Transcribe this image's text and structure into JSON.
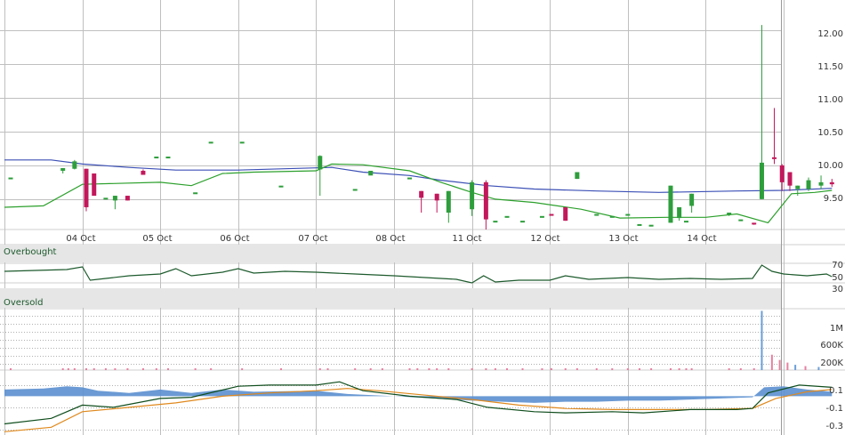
{
  "colors": {
    "up": "#2e9e3c",
    "down": "#c2185b",
    "ma_short": "#2ca02c",
    "ma_long": "#3b4fb5",
    "rsi": "#1c5a2c",
    "volume_up": "#6a9fd8",
    "volume_down": "#e87fa0",
    "macd_line": "#0f4d1c",
    "macd_signal": "#e0891d",
    "histogram": "#5b8fcf",
    "band": "#e6e6e6",
    "grid": "#bfbfbf"
  },
  "chart_data": [
    {
      "id": "price",
      "type": "candlestick",
      "x_labels": [
        "04 Oct",
        "05 Oct",
        "06 Oct",
        "07 Oct",
        "08 Oct",
        "11 Oct",
        "12 Oct",
        "13 Oct",
        "14 Oct"
      ],
      "y_ticks": [
        "12.00",
        "11.50",
        "11.00",
        "10.50",
        "10.00",
        "9.50"
      ],
      "ylim": [
        9.05,
        12.45
      ],
      "grid": true,
      "candles": [
        {
          "t": 0.08,
          "o": 9.82,
          "h": 9.82,
          "l": 9.82,
          "c": 9.82
        },
        {
          "t": 0.75,
          "o": 9.92,
          "h": 9.93,
          "l": 9.88,
          "c": 9.96
        },
        {
          "t": 0.9,
          "o": 9.95,
          "h": 10.08,
          "l": 9.94,
          "c": 10.06
        },
        {
          "t": 1.05,
          "o": 9.95,
          "h": 9.95,
          "l": 9.32,
          "c": 9.38
        },
        {
          "t": 1.15,
          "o": 9.88,
          "h": 9.88,
          "l": 9.55,
          "c": 9.55
        },
        {
          "t": 1.3,
          "o": 9.52,
          "h": 9.52,
          "l": 9.52,
          "c": 9.52
        },
        {
          "t": 1.42,
          "o": 9.48,
          "h": 9.55,
          "l": 9.35,
          "c": 9.55
        },
        {
          "t": 1.58,
          "o": 9.55,
          "h": 9.55,
          "l": 9.48,
          "c": 9.48
        },
        {
          "t": 1.78,
          "o": 9.92,
          "h": 9.94,
          "l": 9.88,
          "c": 9.86
        },
        {
          "t": 1.95,
          "o": 10.13,
          "h": 10.13,
          "l": 10.13,
          "c": 10.13
        },
        {
          "t": 2.1,
          "o": 10.13,
          "h": 10.13,
          "l": 10.13,
          "c": 10.13
        },
        {
          "t": 2.45,
          "o": 9.6,
          "h": 9.6,
          "l": 9.6,
          "c": 9.6
        },
        {
          "t": 2.65,
          "o": 10.35,
          "h": 10.35,
          "l": 10.35,
          "c": 10.35
        },
        {
          "t": 3.05,
          "o": 10.35,
          "h": 10.35,
          "l": 10.35,
          "c": 10.35
        },
        {
          "t": 3.55,
          "o": 9.7,
          "h": 9.7,
          "l": 9.7,
          "c": 9.7
        },
        {
          "t": 4.05,
          "o": 9.94,
          "h": 10.15,
          "l": 9.55,
          "c": 10.14
        },
        {
          "t": 4.5,
          "o": 9.65,
          "h": 9.65,
          "l": 9.65,
          "c": 9.65
        },
        {
          "t": 4.7,
          "o": 9.85,
          "h": 9.85,
          "l": 9.85,
          "c": 9.92
        },
        {
          "t": 5.2,
          "o": 9.82,
          "h": 9.82,
          "l": 9.82,
          "c": 9.82
        },
        {
          "t": 5.35,
          "o": 9.62,
          "h": 9.62,
          "l": 9.3,
          "c": 9.52
        },
        {
          "t": 5.55,
          "o": 9.58,
          "h": 9.58,
          "l": 9.3,
          "c": 9.48
        },
        {
          "t": 5.7,
          "o": 9.3,
          "h": 9.62,
          "l": 9.15,
          "c": 9.62
        },
        {
          "t": 6.0,
          "o": 9.35,
          "h": 9.78,
          "l": 9.25,
          "c": 9.75
        },
        {
          "t": 6.18,
          "o": 9.75,
          "h": 9.78,
          "l": 9.05,
          "c": 9.2
        },
        {
          "t": 6.3,
          "o": 9.18,
          "h": 9.18,
          "l": 9.18,
          "c": 9.18
        },
        {
          "t": 6.45,
          "o": 9.25,
          "h": 9.25,
          "l": 9.25,
          "c": 9.25
        },
        {
          "t": 6.65,
          "o": 9.18,
          "h": 9.18,
          "l": 9.18,
          "c": 9.18
        },
        {
          "t": 6.9,
          "o": 9.25,
          "h": 9.25,
          "l": 9.25,
          "c": 9.25
        },
        {
          "t": 7.02,
          "o": 9.28,
          "h": 9.28,
          "l": 9.28,
          "c": 9.26
        },
        {
          "t": 7.2,
          "o": 9.38,
          "h": 9.38,
          "l": 9.18,
          "c": 9.18
        },
        {
          "t": 7.35,
          "o": 9.8,
          "h": 9.9,
          "l": 9.8,
          "c": 9.9
        },
        {
          "t": 7.6,
          "o": 9.28,
          "h": 9.28,
          "l": 9.28,
          "c": 9.28
        },
        {
          "t": 7.8,
          "o": 9.25,
          "h": 9.25,
          "l": 9.25,
          "c": 9.25
        },
        {
          "t": 8.0,
          "o": 9.28,
          "h": 9.28,
          "l": 9.28,
          "c": 9.28
        },
        {
          "t": 8.15,
          "o": 9.13,
          "h": 9.13,
          "l": 9.13,
          "c": 9.13
        },
        {
          "t": 8.3,
          "o": 9.12,
          "h": 9.12,
          "l": 9.12,
          "c": 9.12
        },
        {
          "t": 8.55,
          "o": 9.15,
          "h": 9.7,
          "l": 9.15,
          "c": 9.7
        },
        {
          "t": 8.66,
          "o": 9.22,
          "h": 9.38,
          "l": 9.18,
          "c": 9.38
        },
        {
          "t": 8.75,
          "o": 9.18,
          "h": 9.18,
          "l": 9.18,
          "c": 9.18
        },
        {
          "t": 8.82,
          "o": 9.4,
          "h": 9.58,
          "l": 9.3,
          "c": 9.58
        },
        {
          "t": 9.3,
          "o": 9.28,
          "h": 9.3,
          "l": 9.25,
          "c": 9.3
        },
        {
          "t": 9.45,
          "o": 9.2,
          "h": 9.2,
          "l": 9.2,
          "c": 9.2
        },
        {
          "t": 9.62,
          "o": 9.15,
          "h": 9.15,
          "l": 9.12,
          "c": 9.14
        },
        {
          "t": 9.72,
          "o": 9.5,
          "h": 12.08,
          "l": 9.5,
          "c": 10.04
        },
        {
          "t": 9.88,
          "o": 10.12,
          "h": 10.85,
          "l": 10.02,
          "c": 10.1
        },
        {
          "t": 9.98,
          "o": 10.0,
          "h": 10.02,
          "l": 9.62,
          "c": 9.75
        },
        {
          "t": 10.08,
          "o": 9.9,
          "h": 9.9,
          "l": 9.62,
          "c": 9.7
        },
        {
          "t": 10.18,
          "o": 9.65,
          "h": 9.7,
          "l": 9.55,
          "c": 9.7
        },
        {
          "t": 10.32,
          "o": 9.65,
          "h": 9.82,
          "l": 9.62,
          "c": 9.78
        },
        {
          "t": 10.48,
          "o": 9.7,
          "h": 9.85,
          "l": 9.65,
          "c": 9.75
        },
        {
          "t": 10.62,
          "o": 9.75,
          "h": 9.8,
          "l": 9.68,
          "c": 9.72
        }
      ],
      "ma_short": [
        [
          0,
          9.38
        ],
        [
          0.5,
          9.4
        ],
        [
          1.0,
          9.72
        ],
        [
          2.0,
          9.75
        ],
        [
          2.4,
          9.7
        ],
        [
          2.8,
          9.88
        ],
        [
          3.2,
          9.9
        ],
        [
          4.0,
          9.92
        ],
        [
          4.2,
          10.02
        ],
        [
          4.6,
          10.01
        ],
        [
          5.2,
          9.92
        ],
        [
          5.6,
          9.75
        ],
        [
          6.0,
          9.6
        ],
        [
          6.3,
          9.5
        ],
        [
          6.8,
          9.45
        ],
        [
          7.4,
          9.35
        ],
        [
          7.9,
          9.22
        ],
        [
          8.5,
          9.23
        ],
        [
          9.0,
          9.23
        ],
        [
          9.4,
          9.28
        ],
        [
          9.8,
          9.15
        ],
        [
          10.1,
          9.58
        ],
        [
          10.4,
          9.6
        ],
        [
          10.62,
          9.63
        ]
      ],
      "ma_long": [
        [
          0,
          10.08
        ],
        [
          0.6,
          10.08
        ],
        [
          1.0,
          10.02
        ],
        [
          1.6,
          9.97
        ],
        [
          2.2,
          9.93
        ],
        [
          3.0,
          9.93
        ],
        [
          3.6,
          9.95
        ],
        [
          4.2,
          9.97
        ],
        [
          4.6,
          9.9
        ],
        [
          5.2,
          9.85
        ],
        [
          5.6,
          9.78
        ],
        [
          6.2,
          9.7
        ],
        [
          6.8,
          9.65
        ],
        [
          7.6,
          9.62
        ],
        [
          8.4,
          9.6
        ],
        [
          9.4,
          9.62
        ],
        [
          10.0,
          9.63
        ],
        [
          10.62,
          9.66
        ]
      ]
    },
    {
      "id": "rsi",
      "type": "line",
      "band_labels": [
        "Overbought",
        "Oversold"
      ],
      "y_ticks": [
        "70",
        "50",
        "30"
      ],
      "ylim": [
        15,
        85
      ],
      "points": [
        [
          0,
          55
        ],
        [
          0.8,
          57
        ],
        [
          1.0,
          60
        ],
        [
          1.1,
          45
        ],
        [
          1.3,
          47
        ],
        [
          1.6,
          50
        ],
        [
          2.0,
          52
        ],
        [
          2.2,
          58
        ],
        [
          2.4,
          50
        ],
        [
          2.8,
          54
        ],
        [
          3.0,
          58
        ],
        [
          3.2,
          53
        ],
        [
          3.6,
          55
        ],
        [
          4.0,
          54
        ],
        [
          4.5,
          52
        ],
        [
          5.0,
          50
        ],
        [
          5.4,
          48
        ],
        [
          5.8,
          46
        ],
        [
          6.0,
          42
        ],
        [
          6.15,
          50
        ],
        [
          6.3,
          43
        ],
        [
          6.6,
          45
        ],
        [
          7.0,
          45
        ],
        [
          7.2,
          50
        ],
        [
          7.5,
          46
        ],
        [
          8.0,
          48
        ],
        [
          8.4,
          46
        ],
        [
          8.8,
          47
        ],
        [
          9.2,
          46
        ],
        [
          9.6,
          47
        ],
        [
          9.72,
          62
        ],
        [
          9.85,
          55
        ],
        [
          10.0,
          52
        ],
        [
          10.3,
          50
        ],
        [
          10.55,
          52
        ],
        [
          10.62,
          49
        ]
      ]
    },
    {
      "id": "volume",
      "type": "bar",
      "y_ticks": [
        "1M",
        "600K",
        "200K"
      ],
      "ylim": [
        0,
        1400000
      ],
      "bars": [
        [
          9.72,
          1350000,
          "up"
        ],
        [
          9.85,
          350000,
          "down"
        ],
        [
          9.95,
          230000,
          "down"
        ],
        [
          10.05,
          170000,
          "down"
        ],
        [
          10.15,
          120000,
          "up"
        ],
        [
          10.28,
          90000,
          "down"
        ],
        [
          10.45,
          70000,
          "up"
        ]
      ],
      "baseline_markers": [
        0.08,
        0.75,
        0.82,
        0.9,
        1.05,
        1.15,
        1.3,
        1.42,
        1.58,
        1.78,
        1.95,
        2.1,
        2.45,
        2.65,
        3.05,
        3.55,
        4.05,
        4.15,
        4.5,
        4.7,
        4.85,
        5.2,
        5.3,
        5.45,
        5.55,
        5.7,
        6.0,
        6.18,
        6.3,
        6.45,
        6.65,
        6.9,
        7.02,
        7.2,
        7.35,
        7.6,
        7.8,
        8.0,
        8.15,
        8.3,
        8.55,
        8.66,
        8.75,
        8.82,
        9.3,
        9.45,
        9.62
      ]
    },
    {
      "id": "macd",
      "type": "line",
      "y_ticks": [
        "0.1",
        "-0.1",
        "-0.3"
      ],
      "ylim": [
        -0.35,
        0.22
      ],
      "histogram": [
        [
          0,
          0.06
        ],
        [
          0.5,
          0.07
        ],
        [
          0.8,
          0.09
        ],
        [
          1.0,
          0.08
        ],
        [
          1.2,
          0.05
        ],
        [
          1.6,
          0.03
        ],
        [
          2.0,
          0.06
        ],
        [
          2.4,
          0.03
        ],
        [
          2.8,
          0.06
        ],
        [
          3.2,
          0.04
        ],
        [
          4.0,
          0.05
        ],
        [
          4.4,
          0.02
        ],
        [
          5.0,
          0.0
        ],
        [
          5.5,
          -0.02
        ],
        [
          6.0,
          -0.04
        ],
        [
          6.4,
          -0.05
        ],
        [
          6.8,
          -0.06
        ],
        [
          7.2,
          -0.05
        ],
        [
          7.6,
          -0.05
        ],
        [
          8.0,
          -0.04
        ],
        [
          8.4,
          -0.04
        ],
        [
          8.8,
          -0.03
        ],
        [
          9.2,
          -0.02
        ],
        [
          9.6,
          -0.01
        ],
        [
          9.75,
          0.08
        ],
        [
          10.0,
          0.09
        ],
        [
          10.3,
          0.06
        ],
        [
          10.62,
          0.04
        ]
      ],
      "macd_line": [
        [
          0,
          -0.25
        ],
        [
          0.6,
          -0.2
        ],
        [
          1.0,
          -0.08
        ],
        [
          1.4,
          -0.1
        ],
        [
          2.0,
          -0.02
        ],
        [
          2.4,
          -0.01
        ],
        [
          3.0,
          0.09
        ],
        [
          3.4,
          0.1
        ],
        [
          4.0,
          0.1
        ],
        [
          4.3,
          0.13
        ],
        [
          4.6,
          0.05
        ],
        [
          5.2,
          0.0
        ],
        [
          5.8,
          -0.03
        ],
        [
          6.2,
          -0.1
        ],
        [
          6.8,
          -0.14
        ],
        [
          7.2,
          -0.15
        ],
        [
          7.8,
          -0.14
        ],
        [
          8.2,
          -0.15
        ],
        [
          8.8,
          -0.12
        ],
        [
          9.4,
          -0.12
        ],
        [
          9.6,
          -0.11
        ],
        [
          9.8,
          0.03
        ],
        [
          10.2,
          0.1
        ],
        [
          10.62,
          0.08
        ]
      ],
      "signal_line": [
        [
          0,
          -0.32
        ],
        [
          0.6,
          -0.28
        ],
        [
          1.0,
          -0.14
        ],
        [
          1.6,
          -0.1
        ],
        [
          2.2,
          -0.06
        ],
        [
          2.8,
          0.0
        ],
        [
          3.4,
          0.03
        ],
        [
          4.0,
          0.05
        ],
        [
          4.4,
          0.07
        ],
        [
          4.8,
          0.05
        ],
        [
          5.4,
          0.01
        ],
        [
          6.0,
          -0.03
        ],
        [
          6.6,
          -0.08
        ],
        [
          7.2,
          -0.11
        ],
        [
          7.8,
          -0.12
        ],
        [
          8.4,
          -0.12
        ],
        [
          9.0,
          -0.12
        ],
        [
          9.6,
          -0.11
        ],
        [
          9.9,
          -0.02
        ],
        [
          10.3,
          0.04
        ],
        [
          10.62,
          0.06
        ]
      ]
    }
  ]
}
